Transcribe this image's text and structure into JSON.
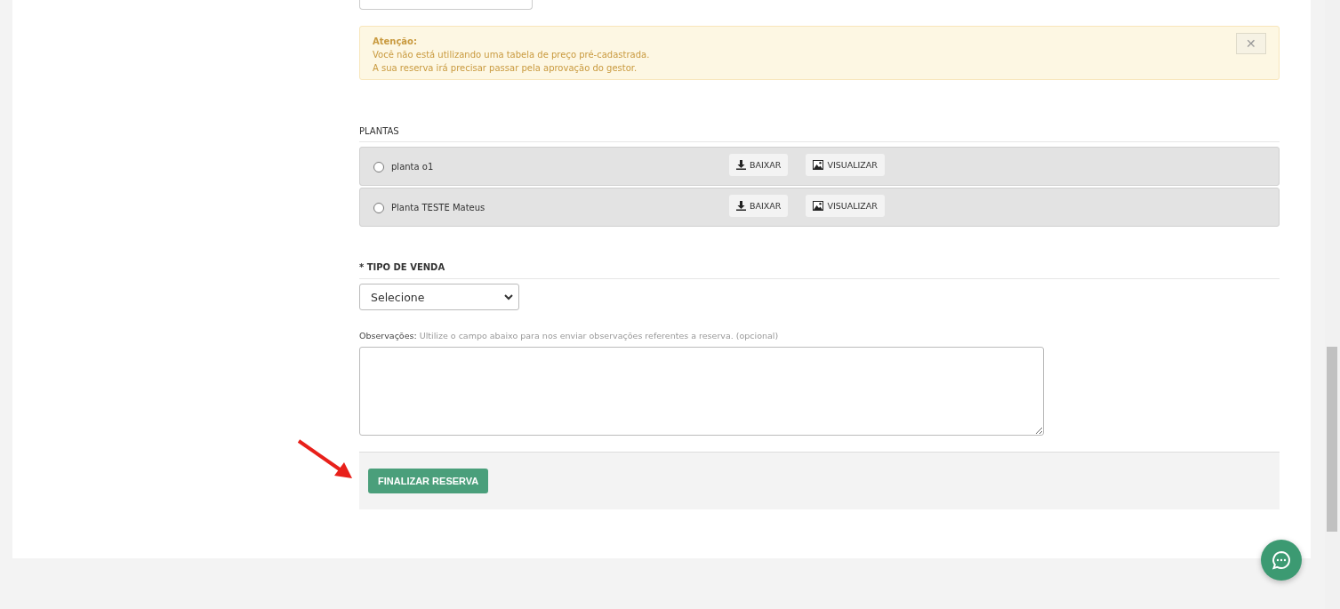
{
  "alert": {
    "title": "Atenção:",
    "lines": [
      "Você não está utilizando uma tabela de preço pré-cadastrada.",
      "A sua reserva irá precisar passar pela aprovação do gestor."
    ],
    "close": "✕"
  },
  "plantas": {
    "heading": "PLANTAS",
    "items": [
      {
        "name": "planta o1",
        "selected": false,
        "download": "BAIXAR",
        "view": "VISUALIZAR"
      },
      {
        "name": "Planta TESTE Mateus",
        "selected": false,
        "download": "BAIXAR",
        "view": "VISUALIZAR"
      }
    ]
  },
  "tipo_venda": {
    "required_mark": "*",
    "label": "TIPO DE VENDA",
    "value": "Selecione"
  },
  "observacoes": {
    "label": "Observações:",
    "hint": "Ultilize o campo abaixo para nos enviar observações referentes a reserva. (opcional)"
  },
  "submit": "FINALIZAR RESERVA"
}
